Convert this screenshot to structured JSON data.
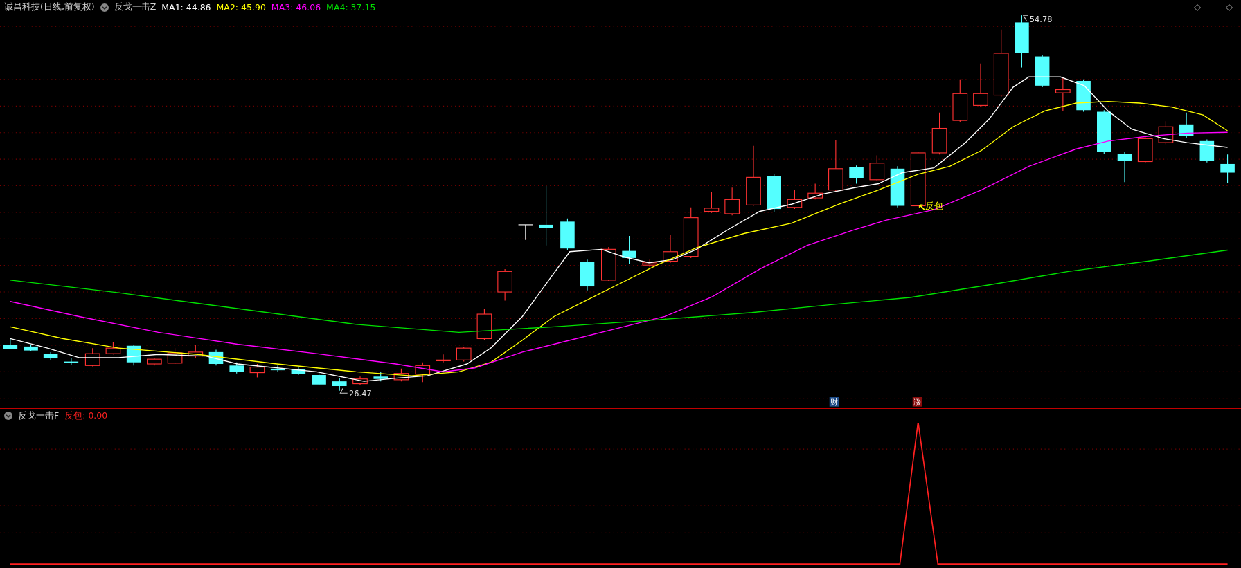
{
  "header": {
    "stock": "诚昌科技(日线,前复权)",
    "indicator": "反戈一击Z",
    "ma": [
      {
        "text": "MA1: 44.86",
        "color": "#ffffff"
      },
      {
        "text": "MA2: 45.90",
        "color": "#ffff00"
      },
      {
        "text": "MA3: 46.06",
        "color": "#ff00ff"
      },
      {
        "text": "MA4: 37.15",
        "color": "#00e000"
      }
    ]
  },
  "chart_labels": {
    "high": "54.78",
    "low": "26.47",
    "signal": "反包"
  },
  "badges": [
    {
      "text": "财",
      "color": "#1c4a86"
    },
    {
      "text": "涨",
      "color": "#8a0c0c"
    }
  ],
  "sub": {
    "indicator": "反戈一击F",
    "reading": "反包: 0.00"
  }
}
